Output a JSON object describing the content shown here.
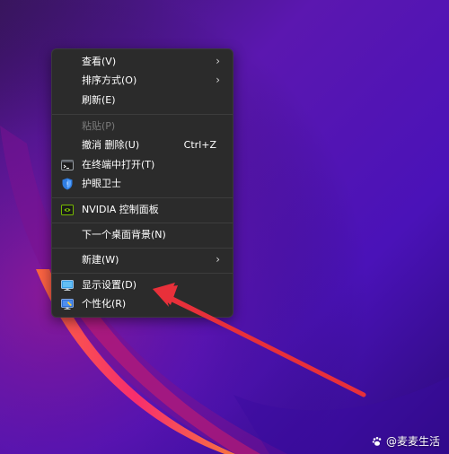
{
  "context_menu": {
    "items": [
      {
        "label": "查看(V)",
        "submenu": true
      },
      {
        "label": "排序方式(O)",
        "submenu": true
      },
      {
        "label": "刷新(E)"
      },
      {
        "label": "粘贴(P)",
        "disabled": true
      },
      {
        "label": "撤消 删除(U)",
        "shortcut": "Ctrl+Z"
      },
      {
        "label": "在终端中打开(T)",
        "icon": "terminal-icon"
      },
      {
        "label": "护眼卫士",
        "icon": "shield-icon"
      },
      {
        "label": "NVIDIA 控制面板",
        "icon": "nvidia-icon"
      },
      {
        "label": "下一个桌面背景(N)"
      },
      {
        "label": "新建(W)",
        "submenu": true
      },
      {
        "label": "显示设置(D)",
        "icon": "display-icon"
      },
      {
        "label": "个性化(R)",
        "icon": "personalize-icon"
      }
    ]
  },
  "watermark": {
    "text": "@麦麦生活"
  },
  "colors": {
    "menu_bg": "#2b2b2b",
    "arrow": "#e8303a",
    "wallpaper_purple": "#5a14a8"
  }
}
